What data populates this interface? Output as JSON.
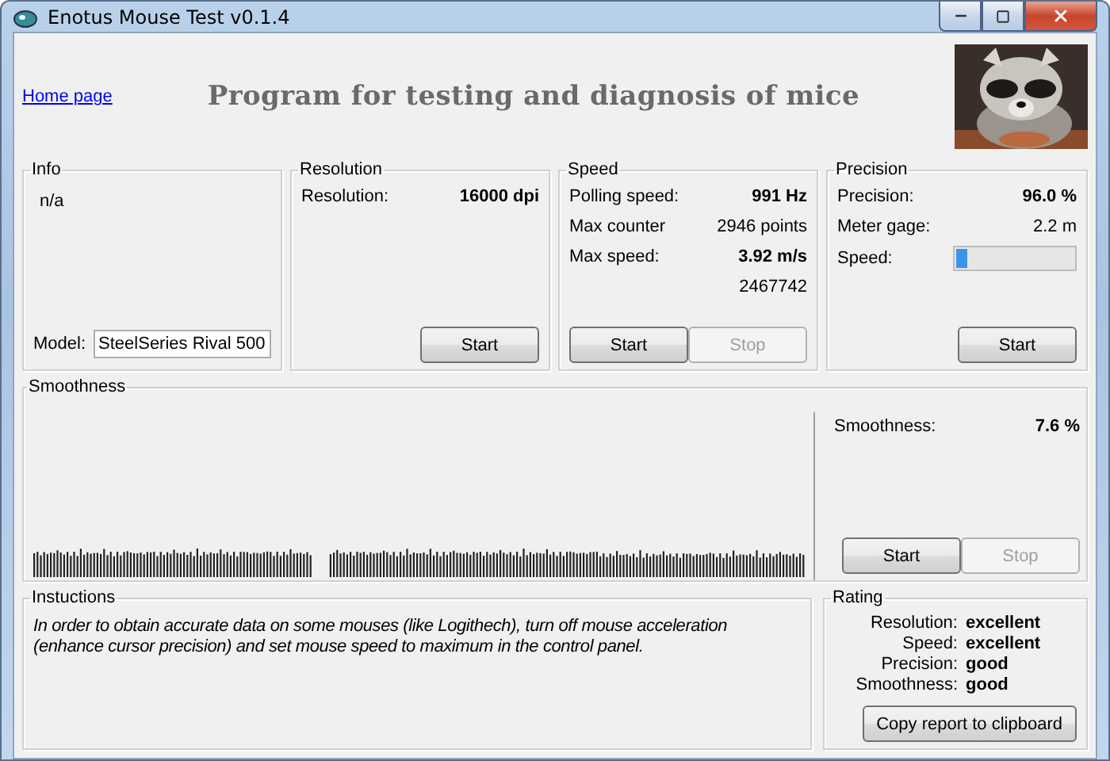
{
  "window": {
    "title": "Enotus Mouse Test v0.1.4"
  },
  "header": {
    "link": "Home page",
    "heading": "Program for testing and diagnosis of mice"
  },
  "info": {
    "title": "Info",
    "text": "n/a",
    "model_label": "Model:",
    "model_value": "SteelSeries Rival 500"
  },
  "resolution": {
    "title": "Resolution",
    "rows": [
      {
        "kind": "value",
        "label": "Resolution:",
        "value": "16000 dpi",
        "bold": true
      }
    ],
    "buttons": [
      {
        "label": "Start",
        "disabled": false
      }
    ]
  },
  "speed": {
    "title": "Speed",
    "rows": [
      {
        "kind": "value",
        "label": "Polling speed:",
        "value": "991 Hz",
        "bold": true
      },
      {
        "kind": "value",
        "label": "Max counter",
        "value": "2946 points",
        "bold": false
      },
      {
        "kind": "value",
        "label": "Max  speed:",
        "value": "3.92 m/s",
        "bold": true
      },
      {
        "kind": "value",
        "value": "2467742",
        "bold": false
      }
    ],
    "buttons": [
      {
        "label": "Start",
        "disabled": false
      },
      {
        "label": "Stop",
        "disabled": true
      }
    ]
  },
  "precision": {
    "title": "Precision",
    "rows": [
      {
        "kind": "value",
        "label": "Precision:",
        "value": "96.0 %",
        "bold": true
      },
      {
        "kind": "value",
        "label": "Meter gage:",
        "value": "2.2 m",
        "bold": false
      },
      {
        "kind": "meter",
        "label": "Speed:",
        "level": 0.1
      }
    ],
    "buttons": [
      {
        "label": "Start",
        "disabled": false
      }
    ]
  },
  "smoothness": {
    "title": "Smoothness",
    "rows": [
      {
        "kind": "value",
        "label": "Smoothness:",
        "value": "7.6 %",
        "bold": true
      }
    ],
    "buttons": [
      {
        "label": "Start",
        "disabled": false
      },
      {
        "label": "Stop",
        "disabled": true
      }
    ]
  },
  "instructions": {
    "title": "Instuctions",
    "text": "In order to obtain accurate data on some mouses (like Logithech), turn off mouse acceleration (enhance cursor precision) and set mouse speed to maximum in the control panel."
  },
  "rating": {
    "title": "Rating",
    "rows": [
      {
        "label": "Resolution:",
        "value": "excellent"
      },
      {
        "label": "Speed:",
        "value": "excellent"
      },
      {
        "label": "Precision:",
        "value": "good"
      },
      {
        "label": "Smoothness:",
        "value": "good"
      }
    ],
    "button": "Copy report to clipboard"
  }
}
